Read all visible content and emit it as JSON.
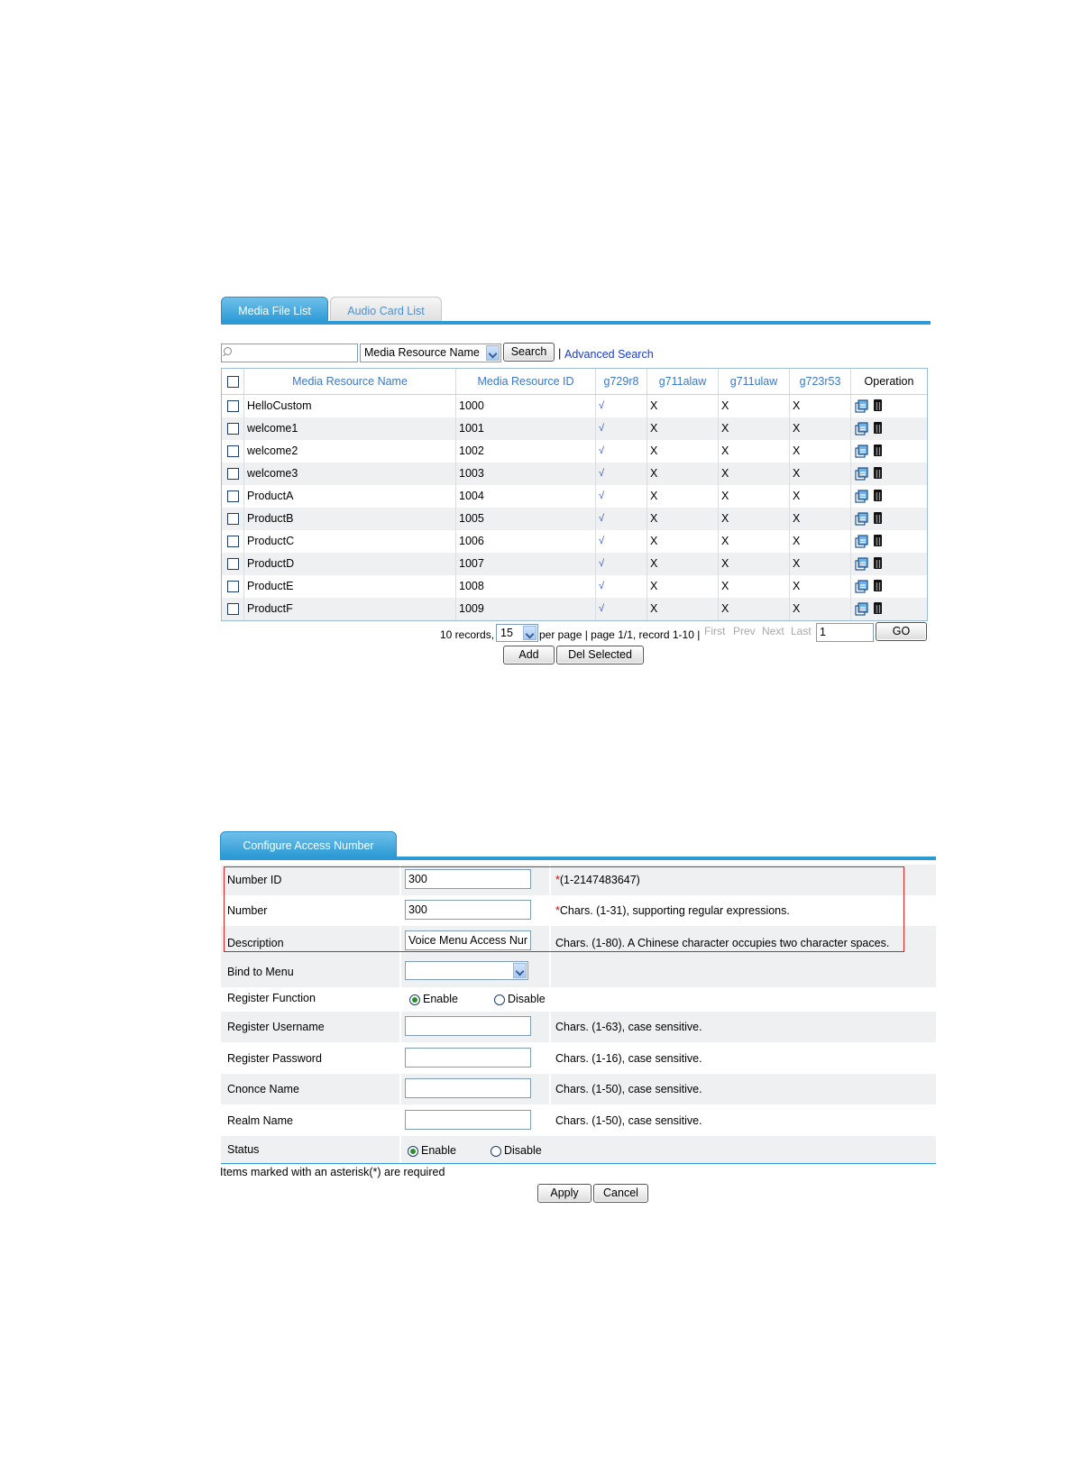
{
  "media": {
    "tabs": [
      {
        "label": "Media File List",
        "active": true
      },
      {
        "label": "Audio Card List",
        "active": false
      }
    ],
    "search": {
      "placeholder": "",
      "field_select": "Media Resource Name",
      "search_button": "Search",
      "separator": "|",
      "advanced_link": "Advanced Search"
    },
    "columns": [
      "Media Resource Name",
      "Media Resource ID",
      "g729r8",
      "g711alaw",
      "g711ulaw",
      "g723r53",
      "Operation"
    ],
    "rows": [
      {
        "name": "HelloCustom",
        "id": "1000",
        "g729r8": "√",
        "g711alaw": "X",
        "g711ulaw": "X",
        "g723r53": "X"
      },
      {
        "name": "welcome1",
        "id": "1001",
        "g729r8": "√",
        "g711alaw": "X",
        "g711ulaw": "X",
        "g723r53": "X"
      },
      {
        "name": "welcome2",
        "id": "1002",
        "g729r8": "√",
        "g711alaw": "X",
        "g711ulaw": "X",
        "g723r53": "X"
      },
      {
        "name": "welcome3",
        "id": "1003",
        "g729r8": "√",
        "g711alaw": "X",
        "g711ulaw": "X",
        "g723r53": "X"
      },
      {
        "name": "ProductA",
        "id": "1004",
        "g729r8": "√",
        "g711alaw": "X",
        "g711ulaw": "X",
        "g723r53": "X"
      },
      {
        "name": "ProductB",
        "id": "1005",
        "g729r8": "√",
        "g711alaw": "X",
        "g711ulaw": "X",
        "g723r53": "X"
      },
      {
        "name": "ProductC",
        "id": "1006",
        "g729r8": "√",
        "g711alaw": "X",
        "g711ulaw": "X",
        "g723r53": "X"
      },
      {
        "name": "ProductD",
        "id": "1007",
        "g729r8": "√",
        "g711alaw": "X",
        "g711ulaw": "X",
        "g723r53": "X"
      },
      {
        "name": "ProductE",
        "id": "1008",
        "g729r8": "√",
        "g711alaw": "X",
        "g711ulaw": "X",
        "g723r53": "X"
      },
      {
        "name": "ProductF",
        "id": "1009",
        "g729r8": "√",
        "g711alaw": "X",
        "g711ulaw": "X",
        "g723r53": "X"
      }
    ],
    "pagination": {
      "records": "10 records,",
      "per_page_value": "15",
      "per_page_text": "per page | page 1/1, record 1-10 |",
      "first": "First",
      "prev": "Prev",
      "next": "Next",
      "last": "Last",
      "page_input": "1",
      "go": "GO"
    },
    "add_button": "Add",
    "del_selected_button": "Del Selected"
  },
  "config": {
    "tab": "Configure Access Number",
    "fields": {
      "number_id": {
        "label": "Number ID",
        "value": "300",
        "hint": "(1-2147483647)",
        "required_mark": "*"
      },
      "number": {
        "label": "Number",
        "value": "300",
        "hint": "Chars. (1-31), supporting regular expressions.",
        "required_mark": "*"
      },
      "description": {
        "label": "Description",
        "value": "Voice Menu Access Nur",
        "hint": "Chars. (1-80). A Chinese character occupies two character spaces."
      },
      "bind_menu": {
        "label": "Bind to Menu",
        "value": ""
      },
      "register_function": {
        "label": "Register Function",
        "enable": "Enable",
        "disable": "Disable",
        "selected": "Enable"
      },
      "register_username": {
        "label": "Register Username",
        "value": "",
        "hint": "Chars. (1-63), case sensitive."
      },
      "register_password": {
        "label": "Register Password",
        "value": "",
        "hint": "Chars. (1-16), case sensitive."
      },
      "cnonce_name": {
        "label": "Cnonce Name",
        "value": "",
        "hint": "Chars. (1-50), case sensitive."
      },
      "realm_name": {
        "label": "Realm Name",
        "value": "",
        "hint": "Chars. (1-50), case sensitive."
      },
      "status": {
        "label": "Status",
        "enable": "Enable",
        "disable": "Disable",
        "selected": "Enable"
      }
    },
    "required_note": "Items marked with an asterisk(*) are required",
    "apply_button": "Apply",
    "cancel_button": "Cancel",
    "highlight_color": "#e02020"
  },
  "colors": {
    "accent": "#2d9ad6",
    "header_text": "#3a78c9",
    "link": "#1a3cc7",
    "row_alt": "#eef0f2"
  }
}
